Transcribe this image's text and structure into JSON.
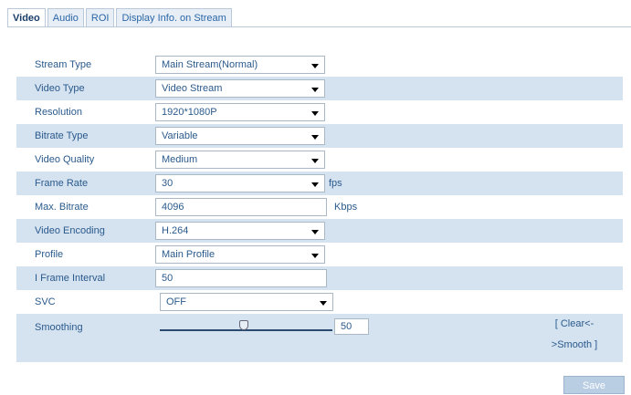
{
  "tabs": [
    "Video",
    "Audio",
    "ROI",
    "Display Info. on Stream"
  ],
  "rows": [
    {
      "label": "Stream Type",
      "value": "Main Stream(Normal)",
      "kind": "select"
    },
    {
      "label": "Video Type",
      "value": "Video Stream",
      "kind": "select"
    },
    {
      "label": "Resolution",
      "value": "1920*1080P",
      "kind": "select"
    },
    {
      "label": "Bitrate Type",
      "value": "Variable",
      "kind": "select"
    },
    {
      "label": "Video Quality",
      "value": "Medium",
      "kind": "select"
    },
    {
      "label": "Frame Rate",
      "value": "30",
      "kind": "select",
      "unit": "fps"
    },
    {
      "label": "Max. Bitrate",
      "value": "4096",
      "kind": "input",
      "unit": "Kbps"
    },
    {
      "label": "Video Encoding",
      "value": "H.264",
      "kind": "select"
    },
    {
      "label": "Profile",
      "value": "Main Profile",
      "kind": "select"
    },
    {
      "label": "I Frame Interval",
      "value": "50",
      "kind": "input"
    },
    {
      "label": "SVC",
      "value": "OFF",
      "kind": "select"
    }
  ],
  "smoothing": {
    "label": "Smoothing",
    "value": "50",
    "note_line1": "[ Clear<-",
    "note_line2": ">Smooth ]"
  },
  "save_label": "Save"
}
